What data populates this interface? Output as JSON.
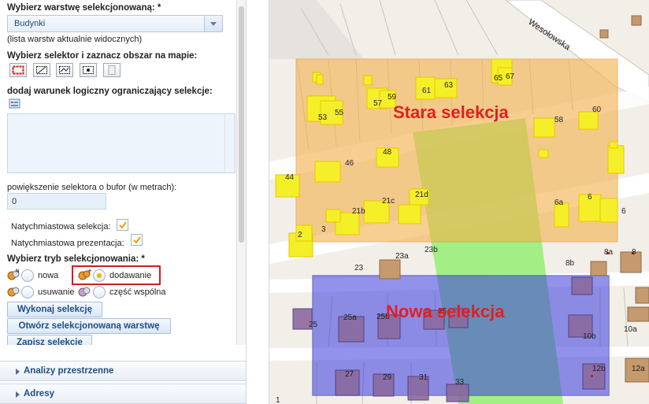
{
  "panel": {
    "layer_label": "Wybierz warstwę selekcjonowaną: *",
    "layer_value": "Budynki",
    "layer_hint": "(lista warstw aktualnie widocznych)",
    "selector_label": "Wybierz selektor i zaznacz obszar na mapie:",
    "tools": [
      "rectangle-select-icon",
      "polygon-select-icon",
      "line-select-icon",
      "point-select-icon",
      "clear-select-icon"
    ],
    "condition_label": "dodaj warunek logiczny ograniczający selekcje:",
    "buffer_label": "powiększenie selektora o bufor (w metrach):",
    "buffer_value": "0",
    "instant_selection": "Natychmiastowa selekcja:",
    "instant_selection_checked": true,
    "instant_presentation": "Natychmiastowa prezentacja:",
    "instant_presentation_checked": true,
    "mode_label": "Wybierz tryb selekcjonowania: *",
    "modes": {
      "new": "nowa",
      "add": "dodawanie",
      "remove": "usuwanie",
      "common": "część wspólna",
      "selected": "add"
    },
    "buttons": {
      "run": "Wykonaj selekcję",
      "open": "Otwórz selekcjonowaną warstwę",
      "save": "Zapisz selekcje"
    }
  },
  "accordion": {
    "spatial": "Analizy przestrzenne",
    "addresses": "Adresy"
  },
  "map": {
    "old_selection_label": "Stara selekcja",
    "new_selection_label": "Nowa selekcja",
    "street": "Wesołowska",
    "labels": {
      "l53": "53",
      "l55": "55",
      "l57": "57",
      "l59": "59",
      "l61": "61",
      "l63": "63",
      "l65": "65",
      "l67": "67",
      "l60": "60",
      "l58": "58",
      "l44": "44",
      "l46": "46",
      "l48": "48",
      "l21d": "21d",
      "l21b": "21b",
      "l21c": "21c",
      "l2": "2",
      "l3": "3",
      "l6a": "6a",
      "l6": "6",
      "l6b": "6",
      "l23a": "23a",
      "l23b": "23b",
      "l23": "23",
      "l8b": "8b",
      "l8a": "8a",
      "l8": "8",
      "l25": "25",
      "l25a": "25a",
      "l25b": "25b",
      "l25c": "25",
      "l10b": "10b",
      "l10a": "10a",
      "l12b": "12b",
      "l12a": "12a",
      "l27": "27",
      "l29": "29",
      "l31": "31",
      "l33": "33",
      "l1": "1"
    },
    "colors": {
      "old_fill": "#f5b04a",
      "new_fill": "#3a3ae0",
      "green": "#9aee7a",
      "selected_building": "#f5ef2a",
      "building": "#c59a6e"
    }
  }
}
